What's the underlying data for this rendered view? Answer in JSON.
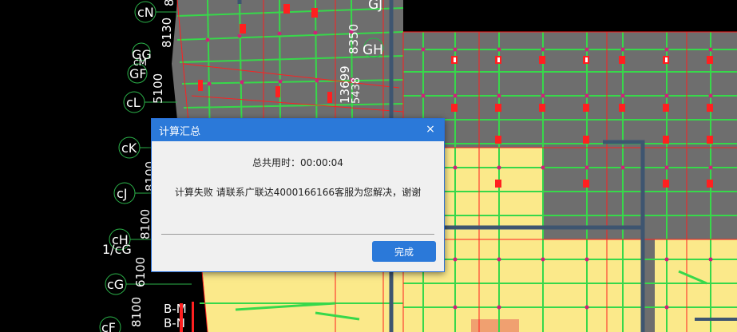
{
  "cad": {
    "axis_labels": [
      "cN",
      "GG",
      "cM",
      "GF",
      "cL",
      "cK",
      "cJ",
      "cH",
      "1/cG",
      "cG",
      "cF"
    ],
    "top_labels": [
      "GJ",
      "GH"
    ],
    "dimensions": [
      "8130",
      "5100",
      "8100",
      "8100",
      "6100",
      "8100",
      "13699",
      "8350",
      "5438",
      "8"
    ],
    "bottom_labels": [
      "B-M",
      "B-N"
    ]
  },
  "dialog": {
    "title": "计算汇总",
    "close_glyph": "×",
    "time_text": "总共用时：00:00:04",
    "message": "计算失败 请联系广联达4000166166客服为您解决，谢谢",
    "ok_label": "完成"
  },
  "colors": {
    "title_bar": "#2b79d9",
    "button": "#2b79d9",
    "dialog_bg": "#f0f0f0"
  }
}
